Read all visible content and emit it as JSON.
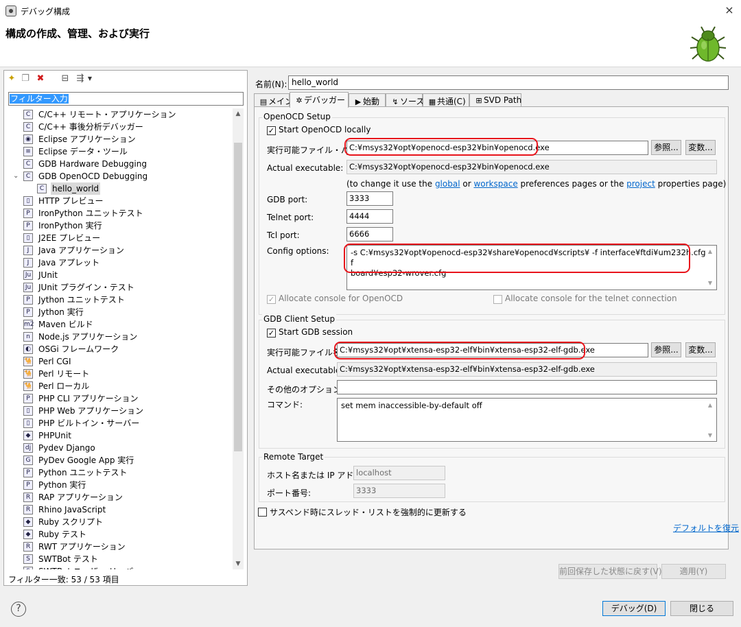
{
  "window": {
    "title": "デバッグ構成",
    "close_icon": "×"
  },
  "header": {
    "heading": "構成の作成、管理、および実行"
  },
  "left": {
    "toolbar": [
      "new-config-icon",
      "duplicate-icon",
      "delete-icon",
      "collapse-all-icon",
      "filter-icon"
    ],
    "filter_placeholder": "フィルター入力",
    "tree": [
      {
        "label": "C/C++ リモート・アプリケーション",
        "icon": "C",
        "level": 1
      },
      {
        "label": "C/C++ 事後分析デバッガー",
        "icon": "C",
        "level": 1
      },
      {
        "label": "Eclipse アプリケーション",
        "icon": "◉",
        "level": 1
      },
      {
        "label": "Eclipse データ・ツール",
        "icon": "≡",
        "level": 1
      },
      {
        "label": "GDB Hardware Debugging",
        "icon": "C",
        "level": 1
      },
      {
        "label": "GDB OpenOCD Debugging",
        "icon": "C",
        "level": 1,
        "expanded": true
      },
      {
        "label": "hello_world",
        "icon": "C",
        "level": 2,
        "selected": true
      },
      {
        "label": "HTTP プレビュー",
        "icon": "▯",
        "level": 1
      },
      {
        "label": "IronPython ユニットテスト",
        "icon": "P",
        "level": 1
      },
      {
        "label": "IronPython 実行",
        "icon": "P",
        "level": 1
      },
      {
        "label": "J2EE プレビュー",
        "icon": "▯",
        "level": 1
      },
      {
        "label": "Java アプリケーション",
        "icon": "J",
        "level": 1
      },
      {
        "label": "Java アプレット",
        "icon": "J",
        "level": 1
      },
      {
        "label": "JUnit",
        "icon": "Ju",
        "level": 1
      },
      {
        "label": "JUnit プラグイン・テスト",
        "icon": "Ju",
        "level": 1
      },
      {
        "label": "Jython ユニットテスト",
        "icon": "P",
        "level": 1
      },
      {
        "label": "Jython 実行",
        "icon": "P",
        "level": 1
      },
      {
        "label": "Maven ビルド",
        "icon": "m2",
        "level": 1
      },
      {
        "label": "Node.js アプリケーション",
        "icon": "n",
        "level": 1
      },
      {
        "label": "OSGi フレームワーク",
        "icon": "◐",
        "level": 1
      },
      {
        "label": "Perl CGI",
        "icon": "🐪",
        "level": 1
      },
      {
        "label": "Perl リモート",
        "icon": "🐪",
        "level": 1
      },
      {
        "label": "Perl ローカル",
        "icon": "🐪",
        "level": 1
      },
      {
        "label": "PHP CLI アプリケーション",
        "icon": "P",
        "level": 1
      },
      {
        "label": "PHP Web アプリケーション",
        "icon": "▯",
        "level": 1
      },
      {
        "label": "PHP ビルトイン・サーバー",
        "icon": "▯",
        "level": 1
      },
      {
        "label": "PHPUnit",
        "icon": "◆",
        "level": 1
      },
      {
        "label": "Pydev Django",
        "icon": "dj",
        "level": 1
      },
      {
        "label": "PyDev Google App 実行",
        "icon": "G",
        "level": 1
      },
      {
        "label": "Python ユニットテスト",
        "icon": "P",
        "level": 1
      },
      {
        "label": "Python 実行",
        "icon": "P",
        "level": 1
      },
      {
        "label": "RAP アプリケーション",
        "icon": "R",
        "level": 1
      },
      {
        "label": "Rhino JavaScript",
        "icon": "R",
        "level": 1
      },
      {
        "label": "Ruby スクリプト",
        "icon": "◆",
        "level": 1
      },
      {
        "label": "Ruby テスト",
        "icon": "◆",
        "level": 1
      },
      {
        "label": "RWT アプリケーション",
        "icon": "R",
        "level": 1
      },
      {
        "label": "SWTBot テスト",
        "icon": "S",
        "level": 1
      },
      {
        "label": "SWTBot ユーザー リーバ",
        "icon": "S",
        "level": 1
      }
    ],
    "filter_status": "フィルター一致: 53 / 53 項目"
  },
  "right": {
    "name_label": "名前(N):",
    "name_value": "hello_world",
    "tabs": [
      {
        "label": "メイン",
        "icon": "▤"
      },
      {
        "label": "デバッガー",
        "icon": "✲",
        "active": true
      },
      {
        "label": "始動",
        "icon": "▶"
      },
      {
        "label": "ソース",
        "icon": "↯"
      },
      {
        "label": "共通(C)",
        "icon": "▦"
      },
      {
        "label": "SVD Path",
        "icon": "⊞"
      }
    ],
    "openocd": {
      "group_title": "OpenOCD Setup",
      "start_locally": "Start OpenOCD locally",
      "exe_label": "実行可能ファイル・パス:",
      "exe_value": "C:¥msys32¥opt¥openocd-esp32¥bin¥openocd.exe",
      "browse_label": "参照...",
      "variables_label": "変数...",
      "actual_label": "Actual executable:",
      "actual_value": "C:¥msys32¥opt¥openocd-esp32¥bin¥openocd.exe",
      "hint_pre": "(to change it use the ",
      "hint_global": "global",
      "hint_or": " or ",
      "hint_workspace": "workspace",
      "hint_mid": " preferences pages or the ",
      "hint_project": "project",
      "hint_post": " properties page)",
      "gdb_port_label": "GDB port:",
      "gdb_port": "3333",
      "telnet_port_label": "Telnet port:",
      "telnet_port": "4444",
      "tcl_port_label": "Tcl port:",
      "tcl_port": "6666",
      "config_label": "Config options:",
      "config_line1": "-s C:¥msys32¥opt¥openocd-esp32¥share¥openocd¥scripts¥ -f interface¥ftdi¥um232h.cfg -f",
      "config_line2": "board¥esp32-wrover.cfg",
      "alloc_console": "Allocate console for OpenOCD",
      "alloc_telnet": "Allocate console for the telnet connection"
    },
    "gdbclient": {
      "group_title": "GDB Client Setup",
      "start_session": "Start GDB session",
      "exe_label": "実行可能ファイル名:",
      "exe_value": "C:¥msys32¥opt¥xtensa-esp32-elf¥bin¥xtensa-esp32-elf-gdb.exe",
      "browse_label": "参照...",
      "variables_label": "変数...",
      "actual_label": "Actual executable:",
      "actual_value": "C:¥msys32¥opt¥xtensa-esp32-elf¥bin¥xtensa-esp32-elf-gdb.exe",
      "other_options_label": "その他のオプション:",
      "other_options_value": "",
      "commands_label": "コマンド:",
      "commands_value": "set mem inaccessible-by-default off"
    },
    "remote": {
      "group_title": "Remote Target",
      "host_label": "ホスト名または IP アドレス:",
      "host_value": "localhost",
      "port_label": "ポート番号:",
      "port_value": "3333"
    },
    "suspend_label": "サスペンド時にスレッド・リストを強制的に更新する",
    "restore_defaults": "デフォルトを復元",
    "revert_label": "前回保存した状態に戻す(V)",
    "apply_label": "適用(Y)"
  },
  "footer": {
    "help_icon": "?",
    "debug_label": "デバッグ(D)",
    "close_label": "閉じる"
  },
  "colors": {
    "highlight_ring": "#e8141b",
    "link": "#0066cc",
    "focus": "#0078d7"
  }
}
